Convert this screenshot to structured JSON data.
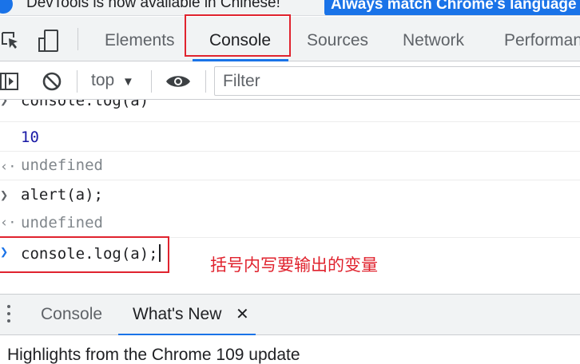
{
  "infobar": {
    "message": "DevTools is now available in Chinese!",
    "button_label": "Always match Chrome's language"
  },
  "tabs": [
    {
      "label": "Elements"
    },
    {
      "label": "Console"
    },
    {
      "label": "Sources"
    },
    {
      "label": "Network"
    },
    {
      "label": "Performance"
    }
  ],
  "active_tab": "Console",
  "toolbar": {
    "context": "top",
    "filter_placeholder": "Filter"
  },
  "console": {
    "rows": [
      {
        "type": "input",
        "text": "console.log(a)"
      },
      {
        "type": "log",
        "text": "10"
      },
      {
        "type": "return",
        "text": "undefined"
      },
      {
        "type": "input",
        "text": "alert(a);"
      },
      {
        "type": "return",
        "text": "undefined"
      }
    ],
    "prompt_text": "console.log(a);",
    "annotation": "括号内写要输出的变量"
  },
  "drawer": {
    "tabs": [
      {
        "label": "Console"
      },
      {
        "label": "What's New"
      }
    ],
    "active_tab": "What's New",
    "highlights_text": "Highlights from the Chrome 109 update"
  },
  "colors": {
    "accent": "#1a73e8",
    "annotation_red": "#e0232e",
    "toolbar_bg": "#f1f3f4"
  }
}
